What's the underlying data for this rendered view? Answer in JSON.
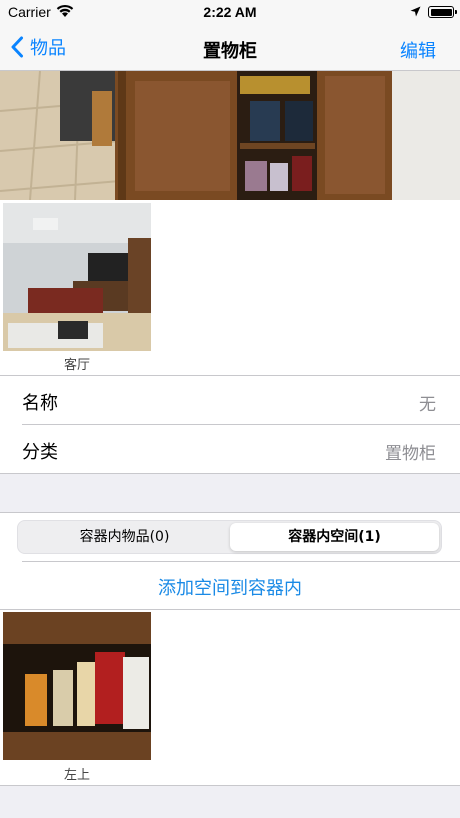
{
  "status": {
    "carrier": "Carrier",
    "time": "2:22 AM"
  },
  "nav": {
    "back_label": "物品",
    "title": "置物柜",
    "edit_label": "编辑"
  },
  "photo": {
    "caption": "客厅"
  },
  "fields": [
    {
      "label": "名称",
      "value": "无"
    },
    {
      "label": "分类",
      "value": "置物柜"
    }
  ],
  "segments": [
    {
      "label": "容器内物品(0)",
      "selected": false
    },
    {
      "label": "容器内空间(1)",
      "selected": true
    }
  ],
  "add_space_label": "添加空间到容器内",
  "spaces": [
    {
      "caption": "左上"
    }
  ],
  "colors": {
    "tint": "#0a84ff",
    "group_background": "#efeff4"
  }
}
